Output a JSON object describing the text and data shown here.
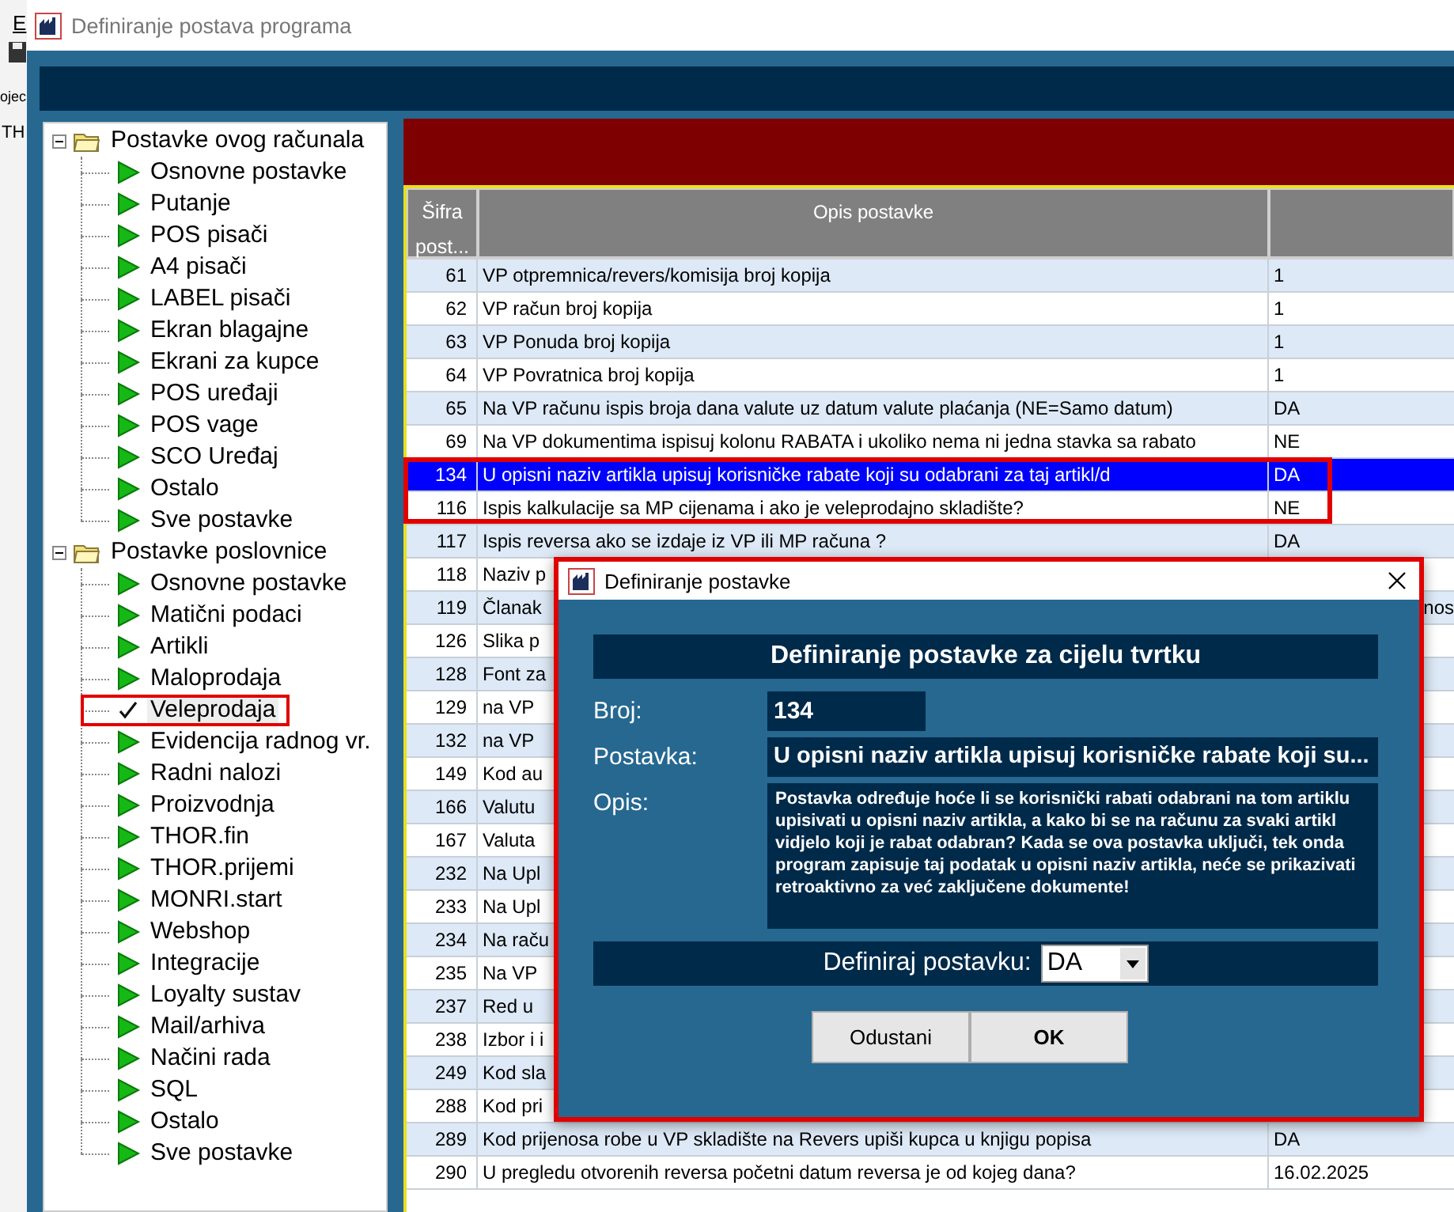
{
  "background_app": {
    "texts": [
      "E",
      "ojec",
      "TH"
    ]
  },
  "window": {
    "title": "Definiranje postava programa"
  },
  "tree": [
    {
      "label": "Postavke ovog računala",
      "expanded": true,
      "children": [
        {
          "label": "Osnovne postavke",
          "selected": false
        },
        {
          "label": "Putanje",
          "selected": false
        },
        {
          "label": "POS pisači",
          "selected": false
        },
        {
          "label": "A4 pisači",
          "selected": false
        },
        {
          "label": "LABEL pisači",
          "selected": false
        },
        {
          "label": "Ekran blagajne",
          "selected": false
        },
        {
          "label": "Ekrani za kupce",
          "selected": false
        },
        {
          "label": "POS uređaji",
          "selected": false
        },
        {
          "label": "POS vage",
          "selected": false
        },
        {
          "label": "SCO Uređaj",
          "selected": false
        },
        {
          "label": "Ostalo",
          "selected": false
        },
        {
          "label": "Sve postavke",
          "selected": false
        }
      ]
    },
    {
      "label": "Postavke poslovnice",
      "expanded": true,
      "children": [
        {
          "label": "Osnovne postavke",
          "selected": false
        },
        {
          "label": "Matični podaci",
          "selected": false
        },
        {
          "label": "Artikli",
          "selected": false
        },
        {
          "label": "Maloprodaja",
          "selected": false
        },
        {
          "label": "Veleprodaja",
          "selected": true
        },
        {
          "label": "Evidencija radnog vr.",
          "selected": false
        },
        {
          "label": "Radni nalozi",
          "selected": false
        },
        {
          "label": "Proizvodnja",
          "selected": false
        },
        {
          "label": "THOR.fin",
          "selected": false
        },
        {
          "label": "THOR.prijemi",
          "selected": false
        },
        {
          "label": "MONRI.start",
          "selected": false
        },
        {
          "label": "Webshop",
          "selected": false
        },
        {
          "label": "Integracije",
          "selected": false
        },
        {
          "label": "Loyalty sustav",
          "selected": false
        },
        {
          "label": "Mail/arhiva",
          "selected": false
        },
        {
          "label": "Načini rada",
          "selected": false
        },
        {
          "label": "SQL",
          "selected": false
        },
        {
          "label": "Ostalo",
          "selected": false
        },
        {
          "label": "Sve postavke",
          "selected": false
        }
      ]
    }
  ],
  "table": {
    "columns": [
      "Šifra post...",
      "Opis postavke"
    ],
    "rows": [
      {
        "number": "61",
        "description": "VP otpremnica/revers/komisija broj kopija",
        "value": "1",
        "selected": false
      },
      {
        "number": "62",
        "description": "VP račun broj kopija",
        "value": "1",
        "selected": false
      },
      {
        "number": "63",
        "description": "VP Ponuda broj kopija",
        "value": "1",
        "selected": false
      },
      {
        "number": "64",
        "description": "VP Povratnica broj kopija",
        "value": "1",
        "selected": false
      },
      {
        "number": "65",
        "description": "Na VP računu ispis broja dana valute uz datum valute plaćanja (NE=Samo datum)",
        "value": "DA",
        "selected": false
      },
      {
        "number": "69",
        "description": "Na VP dokumentima ispisuj kolonu RABATA i ukoliko nema ni jedna stavka sa rabato",
        "value": "NE",
        "selected": false
      },
      {
        "number": "134",
        "description": "U opisni naziv artikla upisuj korisničke rabate koji su odabrani za taj artikl/d",
        "value": "DA",
        "selected": true
      },
      {
        "number": "116",
        "description": "Ispis kalkulacije sa MP cijenama i ako je veleprodajno skladište?",
        "value": "NE",
        "selected": false
      },
      {
        "number": "117",
        "description": "Ispis reversa ako se izdaje iz VP ili MP računa ?",
        "value": "DA",
        "selected": false
      },
      {
        "number": "118",
        "description": "Naziv p",
        "selected": false
      },
      {
        "number": "119",
        "description": "Članak",
        "trailing": "nos",
        "selected": false
      },
      {
        "number": "126",
        "description": "Slika p",
        "selected": false
      },
      {
        "number": "128",
        "description": "Font za",
        "selected": false
      },
      {
        "number": "129",
        "description": "na VP",
        "selected": false
      },
      {
        "number": "132",
        "description": "na VP",
        "selected": false
      },
      {
        "number": "149",
        "description": "Kod au",
        "selected": false
      },
      {
        "number": "166",
        "description": "Valutu",
        "selected": false
      },
      {
        "number": "167",
        "description": "Valuta",
        "selected": false
      },
      {
        "number": "232",
        "description": "Na Upl",
        "selected": false
      },
      {
        "number": "233",
        "description": "Na Upl",
        "selected": false
      },
      {
        "number": "234",
        "description": "Na raču",
        "selected": false
      },
      {
        "number": "235",
        "description": "Na VP",
        "selected": false
      },
      {
        "number": "237",
        "description": "Red u",
        "selected": false
      },
      {
        "number": "238",
        "description": "Izbor i i",
        "selected": false
      },
      {
        "number": "249",
        "description": "Kod sla",
        "selected": false
      },
      {
        "number": "288",
        "description": "Kod pri",
        "selected": false
      },
      {
        "number": "289",
        "description": "Kod prijenosa robe u VP skladište na Revers upiši kupca u knjigu popisa",
        "value": "DA",
        "selected": false
      },
      {
        "number": "290",
        "description": "U pregledu otvorenih reversa početni datum reversa je od kojeg dana?",
        "value": "16.02.2025",
        "selected": false
      }
    ]
  },
  "dialog": {
    "title": "Definiranje postavke",
    "heading": "Definiranje postavke za cijelu tvrtku",
    "fields": [
      {
        "kind": "short",
        "label": "Broj:",
        "value": "134"
      },
      {
        "kind": "line",
        "label": "Postavka:",
        "value": "U opisni naziv artikla upisuj korisničke rabate koji su..."
      },
      {
        "kind": "area",
        "label": "Opis:",
        "value": "Postavka određuje hoće li se korisnički rabati odabrani na tom artiklu upisivati u opisni naziv artikla, a kako bi se na računu za svaki artikl vidjelo koji je rabat odabran?  Kada se ova postavka uključi, tek onda program zapisuje taj podatak u opisni naziv artikla, neće se prikazivati retroaktivno za već zaključene dokumente!"
      }
    ],
    "define": {
      "label": "Definiraj postavku:",
      "value": "DA"
    },
    "buttons": [
      {
        "label": "Odustani",
        "default": false
      },
      {
        "label": "OK",
        "default": true
      }
    ]
  }
}
